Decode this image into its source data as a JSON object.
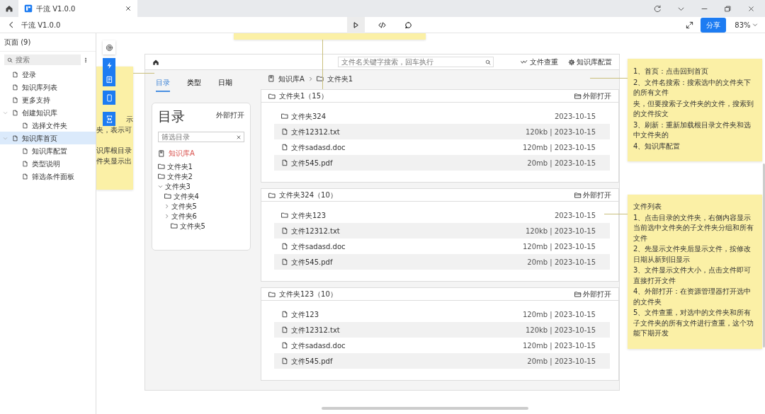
{
  "browser_tab": {
    "title": "千流 V1.0.0"
  },
  "toolbar": {
    "title": "千流 V1.0.0",
    "modes": [
      {
        "kind": "play",
        "selected": true
      },
      {
        "kind": "code",
        "selected": false
      },
      {
        "kind": "comment",
        "selected": false
      }
    ],
    "share": "分享",
    "zoom": "83%"
  },
  "sidebar": {
    "header": "页面 (9)",
    "search": {
      "placeholder": "搜索"
    },
    "items": [
      {
        "label": "登录",
        "selected": false
      },
      {
        "label": "知识库列表",
        "selected": false
      },
      {
        "label": "更多支持",
        "selected": false
      },
      {
        "label": "创建知识库",
        "selected": false,
        "expanded": true,
        "children": [
          {
            "label": "选择文件夹",
            "selected": false
          }
        ]
      },
      {
        "label": "知识库首页",
        "selected": true,
        "expanded": true,
        "children": [
          {
            "label": "知识库配置",
            "selected": false
          },
          {
            "label": "类型说明",
            "selected": false
          },
          {
            "label": "筛选条件面板",
            "selected": false
          }
        ]
      }
    ]
  },
  "canvas": {
    "left_note": {
      "lines": [
        "示",
        "夹，表示可",
        "识库根目录",
        "件夹显示出"
      ]
    },
    "tools": [
      {
        "kind": "target"
      },
      {
        "kind": "bolt"
      },
      {
        "kind": "page"
      },
      {
        "kind": "phone"
      },
      {
        "kind": "code"
      }
    ],
    "notes": [
      {
        "lines": [
          "1、首页：点击回到首页",
          "2、文件名搜索：搜索选中的文件夹下的所有文件",
          "夹，但要搜索子文件夹的文件，搜索到的文件按文",
          "3、刷新：重新加载根目录文件夹和选中文件夹的",
          "4、知识库配置"
        ]
      },
      {
        "title": "文件列表",
        "lines": [
          "1、点击目录的文件夹，右侧内容显示当前选中文件夹的子文件夹分组和所有文件",
          "2、先显示文件夹后显示文件，按修改日期从新到旧显示",
          "3、文件显示文件大小，点击文件即可直接打开文件",
          "4、外部打开：在资源管理器打开选中的文件夹",
          "5、文件查重，对选中的文件夹和所有子文件夹的所有文件进行查重，这个功能下期开发"
        ]
      }
    ]
  },
  "prototype": {
    "search": {
      "placeholder": "文件名关键字搜索，回车执行"
    },
    "actions": [
      {
        "kind": "dedupe",
        "label": "文件查重"
      },
      {
        "kind": "settings",
        "label": "知识库配置"
      }
    ],
    "tabs": [
      {
        "label": "目录",
        "selected": true
      },
      {
        "label": "类型",
        "selected": false
      },
      {
        "label": "日期",
        "selected": false
      }
    ],
    "directory": {
      "title": "目录",
      "open_label": "外部打开",
      "filter": {
        "placeholder": "筛选目录"
      },
      "root": "知识库A",
      "tree": [
        {
          "label": "文件夹1"
        },
        {
          "label": "文件夹2"
        },
        {
          "label": "文件夹3",
          "expanded": true,
          "children": [
            {
              "label": "文件夹4"
            },
            {
              "label": "文件夹5",
              "expanded": false
            },
            {
              "label": "文件夹6",
              "expanded": false,
              "children": [
                {
                  "label": "文件夹5"
                }
              ]
            }
          ]
        }
      ]
    },
    "breadcrumb": [
      {
        "kind": "library",
        "label": "知识库A"
      },
      {
        "kind": "folder",
        "label": "文件夹1"
      }
    ],
    "groups": [
      {
        "title": "文件夹1（15）",
        "open_label": "外部打开",
        "entries": [
          {
            "kind": "folder",
            "name": "文件夹324",
            "meta": "2023-10-15"
          },
          {
            "kind": "file",
            "name": "文件12312.txt",
            "meta": "120kb | 2023-10-15"
          },
          {
            "kind": "file",
            "name": "文件sadasd.doc",
            "meta": "120mb | 2023-10-15"
          },
          {
            "kind": "file",
            "name": "文件545.pdf",
            "meta": "20mb | 2023-10-15"
          }
        ]
      },
      {
        "title": "文件夹324（10）",
        "open_label": "外部打开",
        "entries": [
          {
            "kind": "folder",
            "name": "文件夹123",
            "meta": "2023-10-15"
          },
          {
            "kind": "file",
            "name": "文件12312.txt",
            "meta": "120kb | 2023-10-15"
          },
          {
            "kind": "file",
            "name": "文件sadasd.doc",
            "meta": "120mb | 2023-10-15"
          },
          {
            "kind": "file",
            "name": "文件545.pdf",
            "meta": "20mb | 2023-10-15"
          }
        ]
      },
      {
        "title": "文件夹123（10）",
        "open_label": "外部打开",
        "entries": [
          {
            "kind": "file",
            "name": "文件123",
            "meta": "120mb | 2023-10-15"
          },
          {
            "kind": "file",
            "name": "文件12312.txt",
            "meta": "120kb | 2023-10-15"
          },
          {
            "kind": "file",
            "name": "文件sadasd.doc",
            "meta": "120mb | 2023-10-15"
          },
          {
            "kind": "file",
            "name": "文件545.pdf",
            "meta": "20mb | 2023-10-15"
          }
        ]
      }
    ]
  }
}
